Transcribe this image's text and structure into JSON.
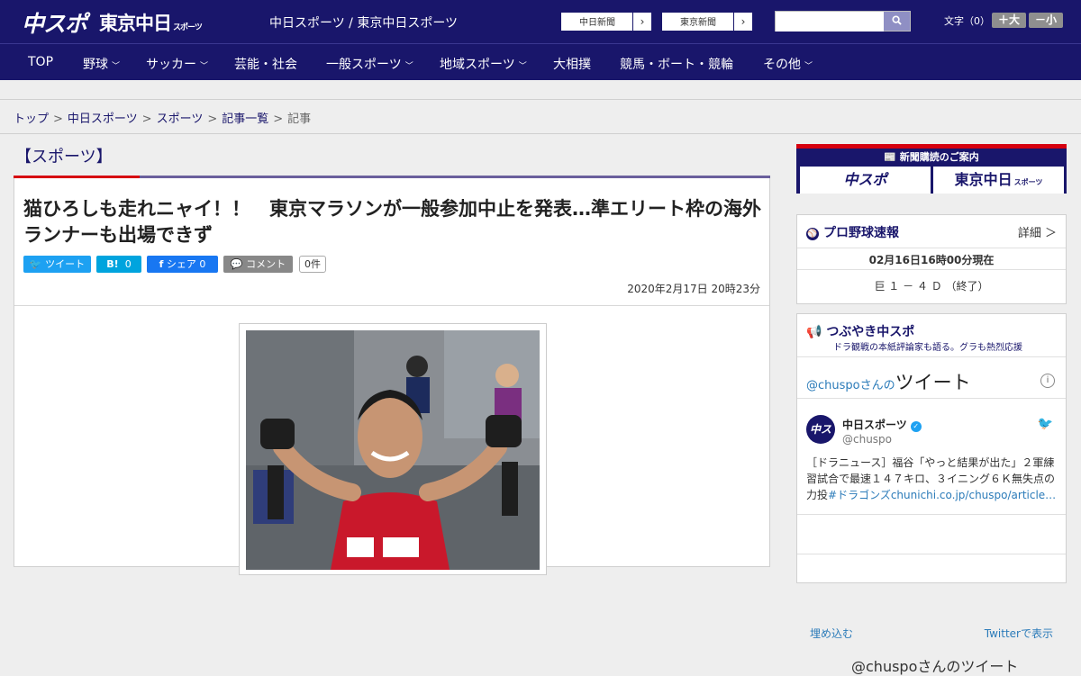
{
  "header": {
    "logo_main": "中スポ",
    "logo_tokyo": "東京中日",
    "logo_tokyo_sub": "スポーツ",
    "tagline": "中日スポーツ / 東京中日スポーツ",
    "paper_links": [
      {
        "label": "中日新聞"
      },
      {
        "label": "東京新聞"
      }
    ],
    "search": {
      "value": "",
      "placeholder": ""
    },
    "font_size_label": "文字（0）",
    "font_larger": "＋大",
    "font_smaller": "－小"
  },
  "nav": {
    "items": [
      {
        "label": "TOP",
        "has_menu": false
      },
      {
        "label": "野球",
        "has_menu": true
      },
      {
        "label": "サッカー",
        "has_menu": true
      },
      {
        "label": "芸能・社会",
        "has_menu": false
      },
      {
        "label": "一般スポーツ",
        "has_menu": true
      },
      {
        "label": "地域スポーツ",
        "has_menu": true
      },
      {
        "label": "大相撲",
        "has_menu": false
      },
      {
        "label": "競馬・ボート・競輪",
        "has_menu": false
      },
      {
        "label": "その他",
        "has_menu": true
      }
    ]
  },
  "breadcrumb": {
    "items": [
      "トップ",
      "中日スポーツ",
      "スポーツ",
      "記事一覧",
      "記事"
    ],
    "separator": ">"
  },
  "article": {
    "section": "【スポーツ】",
    "title": "猫ひろしも走れニャイ！！　東京マラソンが一般参加中止を発表…準エリート枠の海外ランナーも出場できず",
    "share": {
      "tweet": "ツイート",
      "hatena_icon": "B!",
      "hatena_count": "0",
      "facebook": "シェア 0",
      "comment": "コメント",
      "comment_count": "0件"
    },
    "date": "2020年2月17日 20時23分"
  },
  "sidebar": {
    "subscribe": {
      "head": "新聞購読のご案内",
      "chuspo": "中スポ",
      "tokyo": "東京中日",
      "tokyo_sub": "スポーツ"
    },
    "baseball": {
      "title": "プロ野球速報",
      "detail": "詳細 ＞",
      "datetime": "02月16日16時00分現在",
      "score": "巨 １ － ４ Ｄ （終了）"
    },
    "tweets": {
      "title": "つぶやき中スポ",
      "subtitle": "ドラ観戦の本紙評論家も語る。グラも熱烈応援",
      "widget_user": "@chuspoさんの",
      "widget_title": "ツイート",
      "account_name": "中日スポーツ",
      "account_handle": "@chuspo",
      "avatar_text": "中スポ",
      "tweet_text": "［ドラニュース］福谷「やっと結果が出た」２軍練習試合で最速１４７キロ、３イニング６Ｋ無失点の力投",
      "tweet_link": "#ドラゴンズchunichi.co.jp/chuspo/article…",
      "embed": "埋め込む",
      "view_on_twitter": "Twitterで表示",
      "footer_user": "@chuspoさんのツイート"
    }
  },
  "colors": {
    "brand_navy": "#19166b",
    "accent_red": "#d6000f",
    "twitter": "#1da1f2",
    "facebook": "#1877f2",
    "hatena": "#00a4de"
  }
}
